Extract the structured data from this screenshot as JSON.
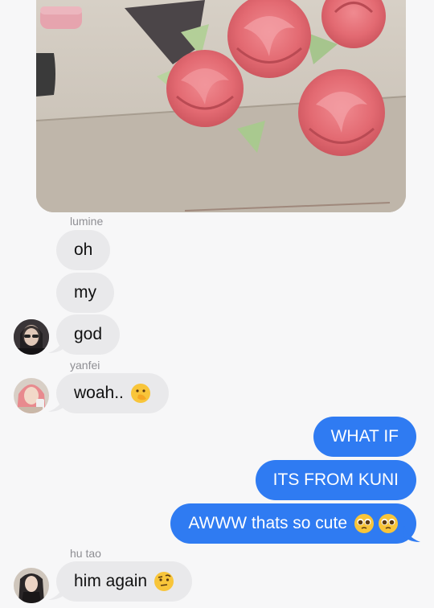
{
  "messages": [
    {
      "sender": "lumine",
      "text": "oh"
    },
    {
      "sender": "lumine",
      "text": "my"
    },
    {
      "sender": "lumine",
      "text": "god"
    },
    {
      "sender": "yanfei",
      "text": "woah..",
      "emoji": "hand-over-mouth-emoji"
    },
    {
      "sender": "me",
      "text": "WHAT IF"
    },
    {
      "sender": "me",
      "text": "ITS FROM KUNI"
    },
    {
      "sender": "me",
      "text": "AWWW thats so cute",
      "emoji": "pleading-face-emoji x2"
    },
    {
      "sender": "hu tao",
      "text": "him again",
      "emoji": "face-with-raised-eyebrow-emoji"
    }
  ],
  "senders": {
    "lumine": "lumine",
    "yanfei": "yanfei",
    "hutao": "hu tao"
  },
  "colors": {
    "outgoing_bubble": "#2f7bf2",
    "incoming_bubble": "#e9e9eb",
    "background": "#f7f7f8"
  }
}
